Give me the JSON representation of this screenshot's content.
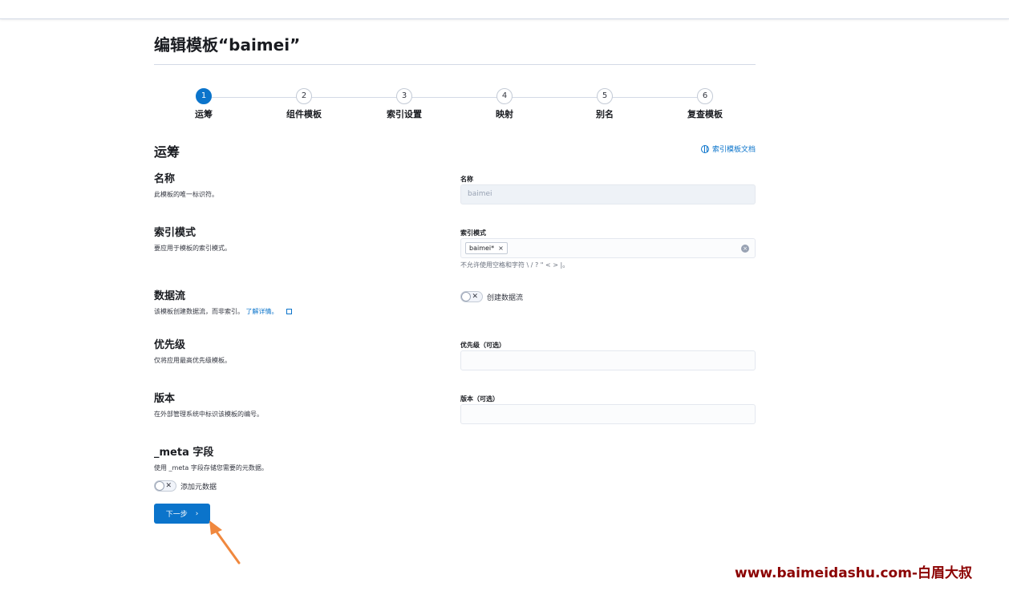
{
  "page": {
    "title": "编辑模板“baimei”"
  },
  "steps": [
    {
      "number": "1",
      "label": "运筹",
      "active": true
    },
    {
      "number": "2",
      "label": "组件模板",
      "active": false
    },
    {
      "number": "3",
      "label": "索引设置",
      "active": false
    },
    {
      "number": "4",
      "label": "映射",
      "active": false
    },
    {
      "number": "5",
      "label": "别名",
      "active": false
    },
    {
      "number": "6",
      "label": "复查模板",
      "active": false
    }
  ],
  "section": {
    "title": "运筹",
    "doc_link": "索引模板文档"
  },
  "fields": {
    "name": {
      "title": "名称",
      "desc": "此模板的唯一标识符。",
      "label": "名称",
      "value": "baimei"
    },
    "index_pattern": {
      "title": "索引模式",
      "desc": "要应用于模板的索引模式。",
      "label": "索引模式",
      "chip": "baimei*",
      "chip_remove": "×",
      "clear": "×",
      "helper": "不允许使用空格和字符 \\ / ? \" < > |。"
    },
    "data_stream": {
      "title": "数据流",
      "desc": "该模板创建数据流，而非索引。",
      "link": "了解详情。",
      "switch_label": "创建数据流",
      "switch_x": "✕"
    },
    "priority": {
      "title": "优先级",
      "desc": "仅将应用最高优先级模板。",
      "label": "优先级（可选）",
      "value": ""
    },
    "version": {
      "title": "版本",
      "desc": "在外部管理系统中标识该模板的编号。",
      "label": "版本（可选）",
      "value": ""
    },
    "meta": {
      "title": "_meta 字段",
      "desc": "使用 _meta 字段存储您需要的元数据。",
      "switch_label": "添加元数据",
      "switch_x": "✕"
    }
  },
  "actions": {
    "next_label": "下一步",
    "next_chevron": "›"
  },
  "watermark": "www.baimeidashu.com-白眉大叔",
  "colors": {
    "accent": "#0b74cb",
    "arrow": "#f0883e",
    "watermark": "#8b0000"
  }
}
